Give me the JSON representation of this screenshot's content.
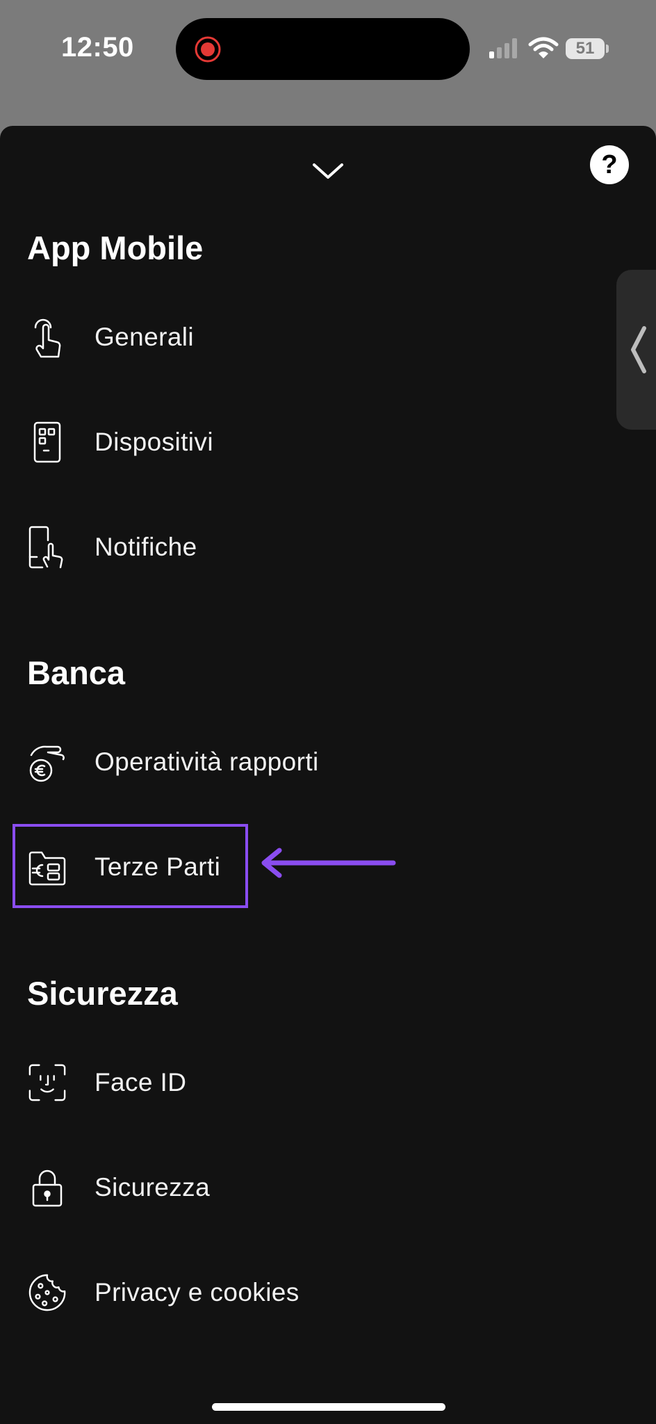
{
  "status_bar": {
    "time": "12:50",
    "battery": "51"
  },
  "sheet": {
    "help_label": "?",
    "sections": {
      "app_mobile": {
        "title": "App Mobile",
        "items": [
          {
            "label": "Generali",
            "icon": "touch-finger-icon"
          },
          {
            "label": "Dispositivi",
            "icon": "device-icon"
          },
          {
            "label": "Notifiche",
            "icon": "phone-tap-icon"
          }
        ]
      },
      "banca": {
        "title": "Banca",
        "items": [
          {
            "label": "Operatività rapporti",
            "icon": "hand-euro-coin-icon"
          },
          {
            "label": "Terze Parti",
            "icon": "euro-folder-icon"
          }
        ]
      },
      "sicurezza": {
        "title": "Sicurezza",
        "items": [
          {
            "label": "Face ID",
            "icon": "face-id-icon"
          },
          {
            "label": "Sicurezza",
            "icon": "padlock-icon"
          },
          {
            "label": "Privacy e cookies",
            "icon": "cookie-icon"
          }
        ]
      }
    }
  },
  "annotation": {
    "highlight_color": "#8a4df0"
  }
}
